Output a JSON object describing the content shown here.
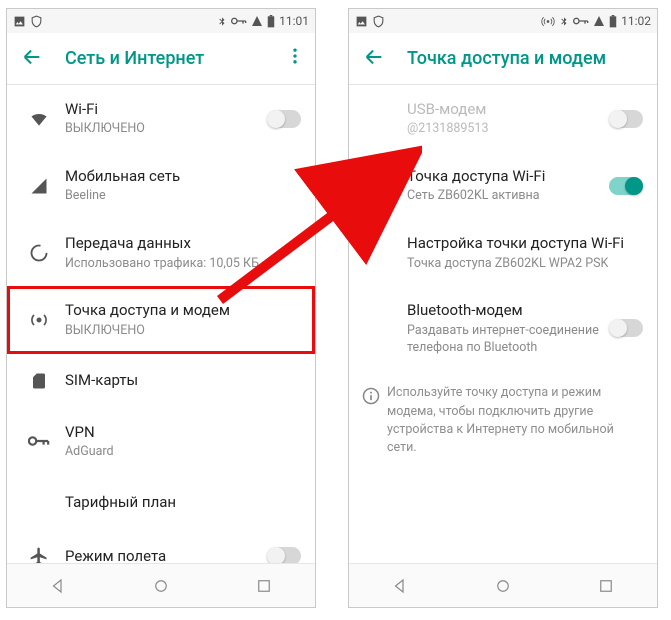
{
  "left": {
    "time": "11:01",
    "title": "Сеть и Интернет",
    "items": [
      {
        "icon": "wifi",
        "primary": "Wi-Fi",
        "secondary": "ВЫКЛЮЧЕНО",
        "switch": "off"
      },
      {
        "icon": "cell",
        "primary": "Мобильная сеть",
        "secondary": "Beeline"
      },
      {
        "icon": "data",
        "primary": "Передача данных",
        "secondary": "Использовано трафика: 10,05 КБ"
      },
      {
        "icon": "hotspot",
        "primary": "Точка доступа и модем",
        "secondary": "ВЫКЛЮЧЕНО",
        "highlight": true
      },
      {
        "icon": "sim",
        "primary": "SIM-карты"
      },
      {
        "icon": "vpn",
        "primary": "VPN",
        "secondary": "AdGuard"
      },
      {
        "icon": "plan",
        "primary": "Тарифный план"
      },
      {
        "icon": "airplane",
        "primary": "Режим полета",
        "switch": "off"
      }
    ]
  },
  "right": {
    "time": "11:02",
    "title": "Точка доступа и модем",
    "items": [
      {
        "primary": "USB-модем",
        "secondary": "@2131889513",
        "switch": "off",
        "disabled": true
      },
      {
        "primary": "Точка доступа Wi-Fi",
        "secondary": "Сеть ZB602KL активна",
        "switch": "on"
      },
      {
        "primary": "Настройка точки доступа Wi-Fi",
        "secondary": "Точка доступа ZB602KL WPA2 PSK"
      },
      {
        "primary": "Bluetooth-модем",
        "secondary": "Раздавать интернет-соединение телефона по Bluetooth",
        "switch": "off"
      }
    ],
    "info": "Используйте точку доступа и режим модема, чтобы подключить другие устройства к Интернету по мобильной сети."
  }
}
